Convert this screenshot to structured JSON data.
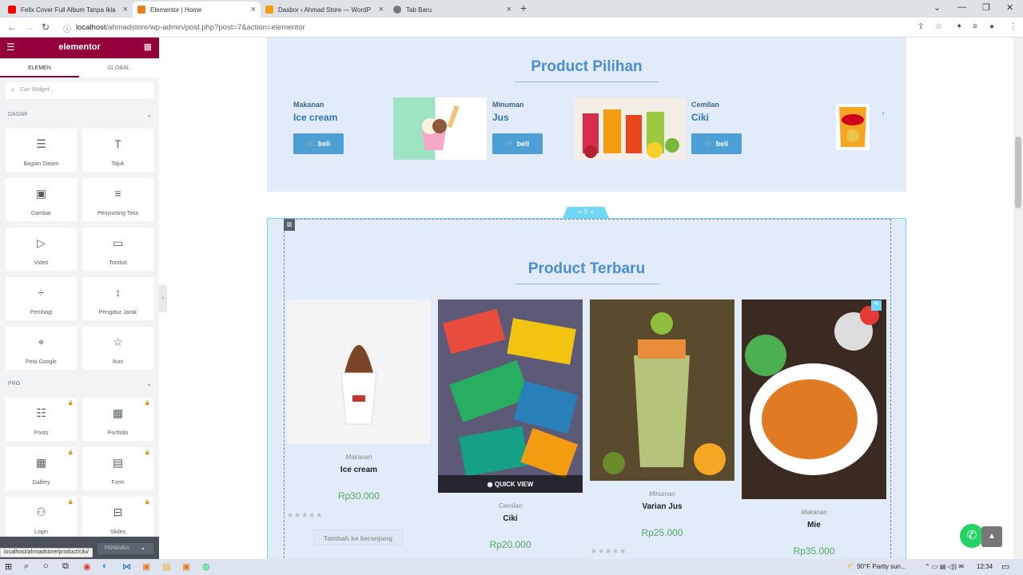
{
  "browser": {
    "tabs": [
      {
        "title": "Felix Cover Full Album Tanpa Ikla",
        "favicon": "youtube-icon",
        "color": "#ff0000"
      },
      {
        "title": "Elementor | Home",
        "favicon": "elementor-icon",
        "color": "#e67e22"
      },
      {
        "title": "Dasbor ‹ Ahmad Store — WordP",
        "favicon": "wordpress-icon",
        "color": "#f39c12"
      },
      {
        "title": "Tab Baru",
        "favicon": "globe-icon",
        "color": "#777777"
      }
    ],
    "url_host": "localhost",
    "url_path": "/ahmadstore/wp-admin/post.php?post=7&action=elementor"
  },
  "panel": {
    "logo": "elementor",
    "tab_elements": "ELEMEN",
    "tab_global": "GLOBAL",
    "search_placeholder": "Cari Widget...",
    "section_basic": "DASAR",
    "section_pro": "PRO",
    "basic_widgets": [
      {
        "label": "Bagian Dalam",
        "icon": "inner-section-icon",
        "glyph": "☰"
      },
      {
        "label": "Tajuk",
        "icon": "heading-icon",
        "glyph": "T"
      },
      {
        "label": "Gambar",
        "icon": "image-icon",
        "glyph": "▣"
      },
      {
        "label": "Penyunting Teks",
        "icon": "text-editor-icon",
        "glyph": "≡"
      },
      {
        "label": "Video",
        "icon": "video-icon",
        "glyph": "▷"
      },
      {
        "label": "Tombol",
        "icon": "button-icon",
        "glyph": "▭"
      },
      {
        "label": "Pembagi",
        "icon": "divider-icon",
        "glyph": "÷"
      },
      {
        "label": "Pengatur Jarak",
        "icon": "spacer-icon",
        "glyph": "↕"
      },
      {
        "label": "Peta Google",
        "icon": "map-icon",
        "glyph": "⌖"
      },
      {
        "label": "Ikon",
        "icon": "star-icon",
        "glyph": "☆"
      }
    ],
    "pro_widgets": [
      {
        "label": "Posts",
        "icon": "posts-icon",
        "glyph": "☷"
      },
      {
        "label": "Portfolio",
        "icon": "portfolio-icon",
        "glyph": "▦"
      },
      {
        "label": "Gallery",
        "icon": "gallery-icon",
        "glyph": "▦"
      },
      {
        "label": "Form",
        "icon": "form-icon",
        "glyph": "▤"
      },
      {
        "label": "Login",
        "icon": "login-icon",
        "glyph": "⚇"
      },
      {
        "label": "Slides",
        "icon": "slides-icon",
        "glyph": "⊟"
      }
    ],
    "publish_label": "PERBARUI"
  },
  "status_url": "localhost/ahmadstore/product/ciki/",
  "pilihan": {
    "title": "Product Pilihan",
    "button_label": "beli",
    "items": [
      {
        "category": "Makanan",
        "name": "Ice cream"
      },
      {
        "category": "Minuman",
        "name": "Jus"
      },
      {
        "category": "Cemilan",
        "name": "Ciki"
      }
    ]
  },
  "terbaru": {
    "title": "Product Terbaru",
    "quick_view": "QUICK VIEW",
    "add_to_cart": "Tambah ke keranjang",
    "products": [
      {
        "category": "Makanan",
        "name": "Ice cream",
        "price": "Rp30.000",
        "rating": 0
      },
      {
        "category": "Cemilan",
        "name": "Ciki",
        "price": "Rp20.000",
        "rating": 0
      },
      {
        "category": "Minuman",
        "name": "Varian Jus",
        "price": "Rp25.000",
        "rating": 0
      },
      {
        "category": "Makanan",
        "name": "Mie",
        "price": "Rp35.000",
        "rating": 0
      }
    ]
  },
  "taskbar": {
    "weather": "90°F  Partly sun...",
    "time": "12:34"
  },
  "colors": {
    "brand": "#93003a",
    "heading": "#4a8ed0",
    "button": "#4f9fd7",
    "price": "#54aa5e"
  }
}
